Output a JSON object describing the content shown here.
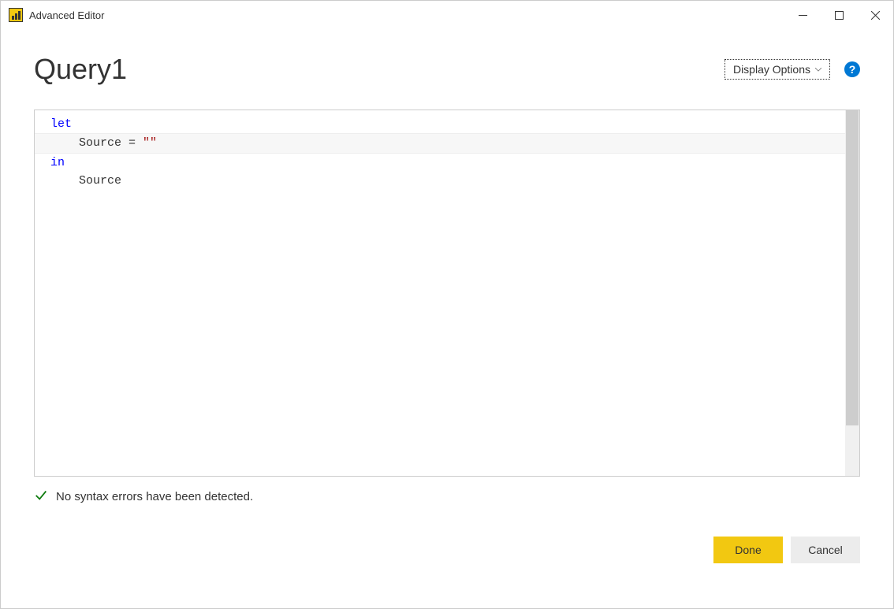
{
  "window": {
    "title": "Advanced Editor"
  },
  "header": {
    "queryName": "Query1",
    "displayOptionsLabel": "Display Options"
  },
  "editor": {
    "tokens": {
      "let": "let",
      "in": "in",
      "indent1": "    ",
      "sourceAssign": "Source = ",
      "emptyString": "\"\"",
      "sourceRef": "Source"
    }
  },
  "status": {
    "message": "No syntax errors have been detected."
  },
  "buttons": {
    "done": "Done",
    "cancel": "Cancel"
  }
}
